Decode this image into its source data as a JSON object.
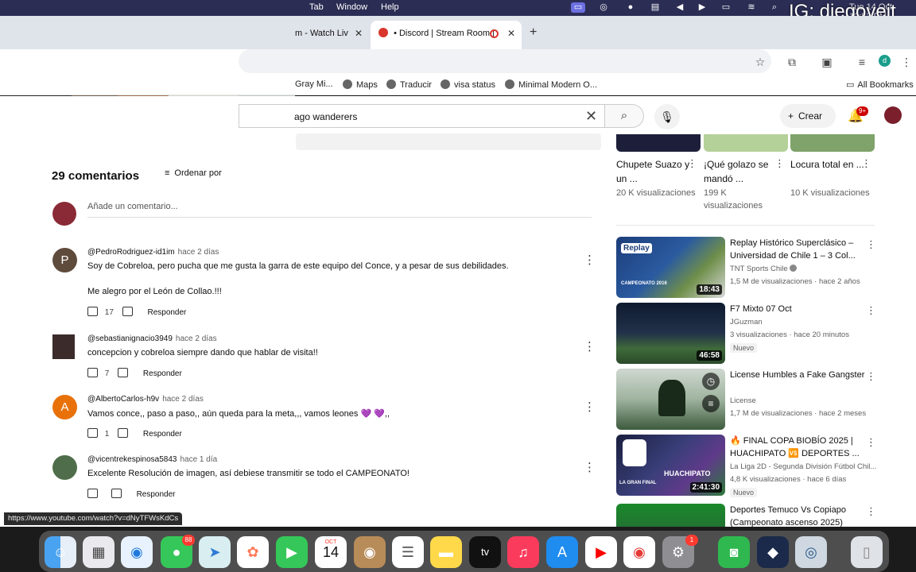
{
  "menubar": {
    "items": [
      "Tab",
      "Window",
      "Help"
    ],
    "clock": "Tue 14 Oct  12:53 PM",
    "watermark": "IG: diegoveit_"
  },
  "tabs": [
    {
      "label": "m - Watch Liv",
      "close": "✕"
    },
    {
      "label": "• Discord | Stream Room |",
      "close": "✕"
    }
  ],
  "new_tab": "+",
  "bookmarks": {
    "items": [
      "Gray Mi...",
      "Maps",
      "Traducir",
      "visa status",
      "Minimal Modern O..."
    ],
    "all": "All Bookmarks"
  },
  "profile_letter": "d",
  "header": {
    "search_value": "ago wanderers",
    "create": "Crear",
    "bell_badge": "9+"
  },
  "comments_section": {
    "count": "29 comentarios",
    "sort": "Ordenar por",
    "add_placeholder": "Añade un comentario...",
    "items": [
      {
        "avatar_letter": "P",
        "avatar_color": "#5f4b3c",
        "author": "@PedroRodriguez-id1im",
        "time": "hace 2 días",
        "line1": "Soy de Cobreloa, pero pucha que me gusta la garra de este equipo del Conce, y a pesar de sus debilidades.",
        "line2": "Me alegro por el León de Collao.!!!",
        "likes": "17",
        "reply": "Responder"
      },
      {
        "avatar_letter": "",
        "avatar_color": "#3b2b2b",
        "author": "@sebastianignacio3949",
        "time": "hace 2 días",
        "line1": "concepcion y cobreloa siempre dando que hablar de visita!!",
        "likes": "7",
        "reply": "Responder"
      },
      {
        "avatar_letter": "A",
        "avatar_color": "#e8710a",
        "author": "@AlbertoCarlos-h9v",
        "time": "hace 2 días",
        "line1": "Vamos conce,, paso a paso,, aún queda para la meta,,, vamos leones 💜 💜,,",
        "likes": "1",
        "reply": "Responder"
      },
      {
        "avatar_letter": "",
        "avatar_color": "#4f6d4a",
        "author": "@vicentrekespinosa5843",
        "time": "hace 1 día",
        "line1": "Excelente Resolución de imagen, así debiese transmitir se todo el CAMPEONATO!",
        "likes": "",
        "reply": "Responder"
      }
    ]
  },
  "top_cards": [
    {
      "title": "Chupete Suazo y un ...",
      "views": "20 K visualizaciones"
    },
    {
      "title": "¡Qué golazo se mandó ...",
      "views": "199 K visualizaciones"
    },
    {
      "title": "Locura total en ...",
      "views": "10 K visualizaciones"
    }
  ],
  "videos": [
    {
      "title": "Replay Histórico Superclásico – Universidad de Chile 1 – 3 Col...",
      "channel": "TNT Sports Chile",
      "meta": "1,5 M de visualizaciones · hace 2 años",
      "duration": "18:43",
      "new": "",
      "thumb_label": "Replay",
      "thumb_caption": "CAMPEONATO 2016"
    },
    {
      "title": "F7 Mixto 07 Oct",
      "channel": "JGuzman",
      "meta": "3 visualizaciones · hace 20 minutos",
      "duration": "46:58",
      "new": "Nuevo",
      "thumb_label": "",
      "thumb_caption": ""
    },
    {
      "title": "License Humbles a Fake Gangster",
      "channel": "License",
      "meta": "1,7 M de visualizaciones · hace 2 meses",
      "duration": "",
      "new": "",
      "thumb_label": "",
      "thumb_caption": ""
    },
    {
      "title": "🔥 FINAL COPA BIOBÍO 2025 | HUACHIPATO 🆚 DEPORTES ...",
      "channel": "La Liga 2D - Segunda División Fútbol Chil...",
      "meta": "4,8 K visualizaciones · hace 6 días",
      "duration": "2:41:30",
      "new": "Nuevo",
      "thumb_label": "HUACHIPATO",
      "thumb_caption": "LA GRAN FINAL"
    },
    {
      "title": "Deportes Temuco Vs Copiapo (Campeonato ascenso 2025)",
      "channel": "",
      "meta": "",
      "duration": "",
      "new": "",
      "thumb_label": "",
      "thumb_caption": ""
    }
  ],
  "status_url": "https://www.youtube.com/watch?v=dNyTFWsKdCs",
  "dock": {
    "calendar_month": "OCT",
    "calendar_day": "14",
    "messages_badge": "88",
    "settings_badge": "1",
    "appletv": "tv"
  }
}
